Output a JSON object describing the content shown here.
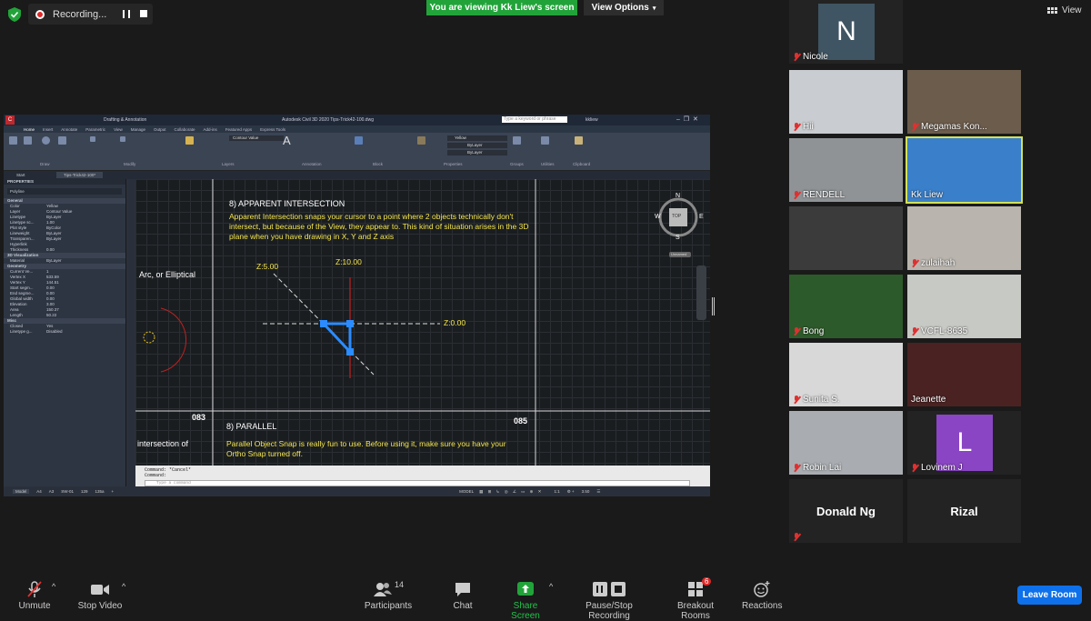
{
  "top_bar": {
    "recording_label": "Recording...",
    "viewing_banner": "You are viewing Kk Liew's screen",
    "view_options": "View Options",
    "view_label": "View"
  },
  "shared_screen": {
    "app_title": "Autodesk Civil 3D 2020   Tips-Trick42-100.dwg",
    "search_placeholder": "Type a keyword or phrase",
    "user": "kkliew",
    "workspace": "Drafting & Annotation",
    "ribbon_tabs": [
      "Home",
      "Insert",
      "Annotate",
      "Parametric",
      "View",
      "Manage",
      "Output",
      "Collaborate",
      "Add-ins",
      "Featured Apps",
      "Express Tools"
    ],
    "ribbon_groups": [
      "Draw",
      "Modify",
      "Layers",
      "Annotation",
      "Block",
      "Properties",
      "Groups",
      "Utilities",
      "Clipboard"
    ],
    "layer_value": "Contour Value",
    "color_value": "Yellow",
    "bylayer": "ByLayer",
    "file_tabs": [
      "Start",
      "Tips-Trick42-100*"
    ],
    "properties": {
      "header": "PROPERTIES",
      "object": "Polyline",
      "sections": [
        {
          "title": "General",
          "rows": [
            [
              "Color",
              "Yellow"
            ],
            [
              "Layer",
              "Contour Value"
            ],
            [
              "Linetype",
              "ByLayer"
            ],
            [
              "Linetype sc...",
              "1.00"
            ],
            [
              "Plot style",
              "ByColor"
            ],
            [
              "Lineweight",
              "ByLayer"
            ],
            [
              "Transparen...",
              "ByLayer"
            ],
            [
              "Hyperlink",
              ""
            ],
            [
              "Thickness",
              "0.00"
            ]
          ]
        },
        {
          "title": "3D Visualization",
          "rows": [
            [
              "Material",
              "ByLayer"
            ]
          ]
        },
        {
          "title": "Geometry",
          "rows": [
            [
              "Current Ve...",
              "1"
            ],
            [
              "Vertex X",
              "533.59"
            ],
            [
              "Vertex Y",
              "144.51"
            ],
            [
              "Start segm...",
              "0.00"
            ],
            [
              "End segme...",
              "0.00"
            ],
            [
              "Global width",
              "0.00"
            ],
            [
              "Elevation",
              "3.00"
            ],
            [
              "Area",
              "150.37"
            ],
            [
              "Length",
              "50.22"
            ]
          ]
        },
        {
          "title": "Misc",
          "rows": [
            [
              "Closed",
              "Yes"
            ],
            [
              "Linetype g...",
              "Disabled"
            ]
          ]
        }
      ]
    },
    "canvas": {
      "heading_1": "8) APPARENT INTERSECTION",
      "body_1": "Apparent Intersection snaps your cursor to a point where 2 objects technically don't intersect, but because of the View, they appear to. This kind of situation arises in the 3D plane when you have drawing in X, Y and Z axis",
      "left_label": "Arc, or Elliptical",
      "z1": "Z:5.00",
      "z2": "Z:10.00",
      "z3": "Z:0.00",
      "num_left": "083",
      "num_right": "085",
      "heading_2": "8) PARALLEL",
      "left_label_2": "intersection of",
      "body_2": "Parallel Object Snap is really fun to use. Before using it, make sure you have your Ortho Snap turned off.",
      "compass": {
        "n": "N",
        "s": "S",
        "e": "E",
        "w": "W",
        "top": "TOP",
        "unnamed": "Unnamed"
      }
    },
    "command": {
      "line1": "Command: *Cancel*",
      "line2": "Command:",
      "placeholder": "Type a command"
    },
    "layout_tabs": [
      "Model",
      "A4",
      "A3",
      "SW-01",
      "129",
      "135a"
    ],
    "status_model": "MODEL",
    "status_scale": "1:1",
    "status_num": "3.50"
  },
  "participants": [
    {
      "name": "Hii",
      "muted": true
    },
    {
      "name": "Megamas Kon...",
      "muted": true
    },
    {
      "name": "RENDELL",
      "muted": true
    },
    {
      "name": "Kk Liew",
      "muted": false,
      "active": true
    },
    {
      "name": "",
      "muted": false
    },
    {
      "name": "zulaihah",
      "muted": true
    },
    {
      "name": "Bong",
      "muted": true
    },
    {
      "name": "VCFL-8635",
      "muted": true
    },
    {
      "name": "Sunita S.",
      "muted": true
    },
    {
      "name": "Jeanette",
      "muted": false
    },
    {
      "name": "Robin Lai",
      "muted": true
    },
    {
      "name": "Lovinem J",
      "muted": true,
      "avatar": "L",
      "avatar_color": "#8a45c4"
    },
    {
      "name": "Donald Ng",
      "muted": true,
      "name_only": true
    },
    {
      "name": "Rizal",
      "muted": false,
      "name_only": true
    },
    {
      "name": "Nicole",
      "muted": true,
      "avatar": "N",
      "avatar_color": "#3f5563"
    }
  ],
  "toolbar": {
    "unmute": "Unmute",
    "stop_video": "Stop Video",
    "participants": "Participants",
    "participant_count": "14",
    "chat": "Chat",
    "share_screen": "Share Screen",
    "recording": "Pause/Stop Recording",
    "breakout": "Breakout Rooms",
    "breakout_badge": "6",
    "reactions": "Reactions",
    "leave": "Leave Room"
  },
  "colors": {
    "zoom_green": "#22a33a",
    "leave_blue": "#0e71eb",
    "active_border": "#d4e157",
    "cad_yellow": "#f5e64a",
    "snap_blue": "#2b8cff"
  }
}
